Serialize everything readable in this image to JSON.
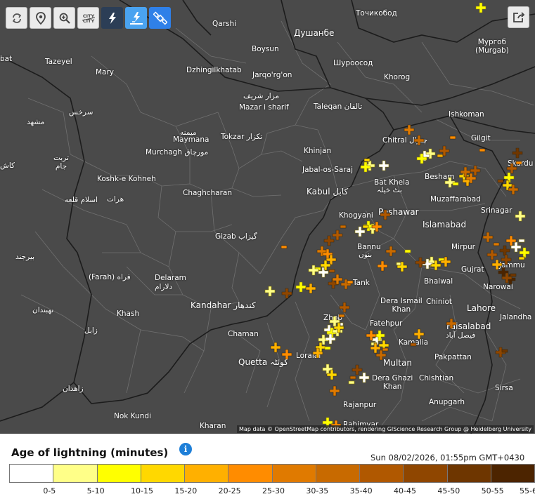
{
  "toolbar": {
    "buttons": [
      {
        "name": "refresh-icon",
        "style": "light"
      },
      {
        "name": "location-icon",
        "style": "light"
      },
      {
        "name": "zoom-icon",
        "style": "light"
      },
      {
        "name": "city-labels-icon",
        "style": "light",
        "text": "CITY"
      },
      {
        "name": "lightning-icon",
        "style": "dark"
      },
      {
        "name": "lightning-ground-icon",
        "style": "lightblue"
      },
      {
        "name": "satellite-icon",
        "style": "blue"
      }
    ],
    "share_icon": "share-icon"
  },
  "map": {
    "attribution": "Map data © OpenStreetMap contributors, rendering GIScience Research Group @ Heidelberg University",
    "colors": {
      "land": "#4a4a4a",
      "border": "#1c1c1c",
      "district": "#6a6a6a"
    },
    "labels": [
      {
        "text": "Qarshi"
      },
      {
        "text": "Душанбе"
      },
      {
        "text": "Точикобод"
      },
      {
        "text": "Boysun"
      },
      {
        "text": "Мургоб (Murgab)"
      },
      {
        "text": "bat"
      },
      {
        "text": "Tazeyel"
      },
      {
        "text": "Mary"
      },
      {
        "text": "Dzhingilkhatab"
      },
      {
        "text": "Jarqo'rg'on"
      },
      {
        "text": "Шуроосод"
      },
      {
        "text": "Khorog"
      },
      {
        "text": "مزار شریف"
      },
      {
        "text": "Mazar i sharif"
      },
      {
        "text": "Taleqan تالقان"
      },
      {
        "text": "سرخس"
      },
      {
        "text": "مشهد"
      },
      {
        "text": "Ishkoman"
      },
      {
        "text": "میمنه"
      },
      {
        "text": "Maymana"
      },
      {
        "text": "Tokzar تکزار"
      },
      {
        "text": "Gilgit"
      },
      {
        "text": "Chitral چترال"
      },
      {
        "text": "Khinjan"
      },
      {
        "text": "Murchagh مورچاق"
      },
      {
        "text": "کاش"
      },
      {
        "text": "تربت جام"
      },
      {
        "text": "Jabal-os-Saraj"
      },
      {
        "text": "Skardu"
      },
      {
        "text": "Besham"
      },
      {
        "text": "Bat Khela"
      },
      {
        "text": "بٹ خیلہ"
      },
      {
        "text": "Koshk-e Kohneh"
      },
      {
        "text": "Kabul کابل"
      },
      {
        "text": "Muzaffarabad"
      },
      {
        "text": "هرات"
      },
      {
        "text": "Chaghcharan"
      },
      {
        "text": "اسلام قلعه"
      },
      {
        "text": "Srinagar"
      },
      {
        "text": "Khogyani"
      },
      {
        "text": "Peshawar"
      },
      {
        "text": "Islamabad"
      },
      {
        "text": "Gizab گیزاب"
      },
      {
        "text": "Bannu"
      },
      {
        "text": "بنوں"
      },
      {
        "text": "Mirpur"
      },
      {
        "text": "Jammu"
      },
      {
        "text": "بیرجند"
      },
      {
        "text": "Gujrat"
      },
      {
        "text": "(Farah) فراه"
      },
      {
        "text": "Delaram"
      },
      {
        "text": "دلارام"
      },
      {
        "text": "Tank"
      },
      {
        "text": "Bhalwal"
      },
      {
        "text": "Narowal"
      },
      {
        "text": "Dera Ismail Khan"
      },
      {
        "text": "Chiniot"
      },
      {
        "text": "Lahore"
      },
      {
        "text": "نهبندان"
      },
      {
        "text": "Khash"
      },
      {
        "text": "Kandahar کندهار"
      },
      {
        "text": "Jalandha"
      },
      {
        "text": "Zhob"
      },
      {
        "text": "Fatehpur"
      },
      {
        "text": "Faisalabad"
      },
      {
        "text": "زابل"
      },
      {
        "text": "Chaman"
      },
      {
        "text": "فیصل آباد"
      },
      {
        "text": "Kamalia"
      },
      {
        "text": "Loralai"
      },
      {
        "text": "Quetta کوئٹہ"
      },
      {
        "text": "Pakpattan"
      },
      {
        "text": "Multan"
      },
      {
        "text": "Chishtian"
      },
      {
        "text": "Dera Ghazi Khan"
      },
      {
        "text": "زاهدان"
      },
      {
        "text": "Sirsa"
      },
      {
        "text": "Anupgarh"
      },
      {
        "text": "Rajanpur"
      },
      {
        "text": "Nok Kundi"
      },
      {
        "text": "Kharan"
      },
      {
        "text": "Rahimyar"
      }
    ]
  },
  "legend": {
    "title": "Age of lightning (minutes)",
    "info_icon": "info-icon",
    "timestamp": "Sun 08/02/2026, 01:55pm GMT+0430",
    "colors": [
      "#ffffff",
      "#ffff88",
      "#ffff00",
      "#ffd800",
      "#ffb000",
      "#ff8c00",
      "#e07a00",
      "#c86a00",
      "#b05800",
      "#8f4600",
      "#6e3600",
      "#4c2400"
    ],
    "ticks": [
      "0-5",
      "5-10",
      "10-15",
      "15-20",
      "20-25",
      "25-30",
      "30-35",
      "35-40",
      "40-45",
      "45-50",
      "50-55",
      "55-6"
    ]
  },
  "strikes": {
    "description_levels": "0 = 0-5 min (white) ... 11 = 55-60 min (darkest brown)",
    "points": [
      [
        526,
        236,
        1
      ],
      [
        546,
        236,
        0
      ],
      [
        520,
        238,
        2
      ],
      [
        522,
        228,
        3
      ],
      [
        612,
        219,
        1
      ],
      [
        604,
        222,
        0
      ],
      [
        600,
        226,
        2
      ],
      [
        626,
        222,
        4
      ],
      [
        582,
        185,
        6
      ],
      [
        596,
        200,
        7
      ],
      [
        632,
        215,
        8
      ],
      [
        644,
        196,
        5
      ],
      [
        660,
        251,
        3
      ],
      [
        665,
        258,
        4
      ],
      [
        640,
        260,
        1
      ],
      [
        648,
        262,
        2
      ],
      [
        670,
        254,
        6
      ],
      [
        662,
        245,
        7
      ],
      [
        676,
        243,
        8
      ],
      [
        712,
        258,
        9
      ],
      [
        724,
        253,
        2
      ],
      [
        722,
        264,
        3
      ],
      [
        730,
        270,
        7
      ],
      [
        738,
        232,
        5
      ],
      [
        728,
        240,
        8
      ],
      [
        740,
        308,
        1
      ],
      [
        718,
        357,
        10
      ],
      [
        742,
        343,
        0
      ],
      [
        734,
        352,
        0
      ],
      [
        746,
        360,
        2
      ],
      [
        727,
        343,
        5
      ],
      [
        706,
        348,
        6
      ],
      [
        694,
        338,
        7
      ],
      [
        700,
        363,
        8
      ],
      [
        720,
        370,
        9
      ],
      [
        742,
        368,
        3
      ],
      [
        707,
        377,
        4
      ],
      [
        716,
        388,
        11
      ],
      [
        726,
        398,
        11
      ],
      [
        730,
        392,
        10
      ],
      [
        721,
        396,
        9
      ],
      [
        614,
        373,
        1
      ],
      [
        608,
        376,
        0
      ],
      [
        628,
        370,
        2
      ],
      [
        634,
        373,
        4
      ],
      [
        620,
        378,
        3
      ],
      [
        598,
        374,
        9
      ],
      [
        568,
        376,
        1
      ],
      [
        572,
        380,
        3
      ],
      [
        544,
        379,
        5
      ],
      [
        556,
        358,
        7
      ],
      [
        580,
        358,
        2
      ],
      [
        530,
        326,
        1
      ],
      [
        524,
        322,
        2
      ],
      [
        512,
        330,
        0
      ],
      [
        520,
        323,
        3
      ],
      [
        536,
        323,
        5
      ],
      [
        480,
        335,
        8
      ],
      [
        468,
        343,
        9
      ],
      [
        488,
        323,
        7
      ],
      [
        458,
        358,
        6
      ],
      [
        466,
        362,
        5
      ],
      [
        471,
        370,
        4
      ],
      [
        452,
        383,
        2
      ],
      [
        446,
        385,
        1
      ],
      [
        460,
        388,
        0
      ],
      [
        463,
        378,
        3
      ],
      [
        472,
        386,
        8
      ],
      [
        474,
        404,
        9
      ],
      [
        480,
        398,
        6
      ],
      [
        492,
        405,
        7
      ],
      [
        498,
        402,
        5
      ],
      [
        428,
        409,
        2
      ],
      [
        442,
        411,
        4
      ],
      [
        384,
        415,
        1
      ],
      [
        404,
        352,
        5
      ],
      [
        408,
        418,
        9
      ],
      [
        468,
        470,
        0
      ],
      [
        476,
        458,
        1
      ],
      [
        484,
        462,
        0
      ],
      [
        472,
        474,
        2
      ],
      [
        460,
        484,
        1
      ],
      [
        456,
        495,
        3
      ],
      [
        466,
        496,
        2
      ],
      [
        452,
        503,
        4
      ],
      [
        470,
        483,
        0
      ],
      [
        480,
        472,
        1
      ],
      [
        486,
        450,
        6
      ],
      [
        490,
        438,
        8
      ],
      [
        482,
        467,
        3
      ],
      [
        536,
        484,
        0
      ],
      [
        532,
        490,
        1
      ],
      [
        540,
        478,
        2
      ],
      [
        546,
        492,
        3
      ],
      [
        534,
        496,
        4
      ],
      [
        548,
        498,
        6
      ],
      [
        542,
        506,
        7
      ],
      [
        528,
        478,
        5
      ],
      [
        508,
        527,
        9
      ],
      [
        502,
        538,
        7
      ],
      [
        476,
        557,
        6
      ],
      [
        466,
        526,
        1
      ],
      [
        472,
        534,
        3
      ],
      [
        500,
        545,
        1
      ],
      [
        518,
        538,
        0
      ],
      [
        392,
        495,
        4
      ],
      [
        408,
        505,
        5
      ],
      [
        588,
        491,
        8
      ],
      [
        596,
        476,
        4
      ],
      [
        642,
        461,
        7
      ],
      [
        712,
        502,
        9
      ],
      [
        718,
        500,
        10
      ],
      [
        466,
        602,
        2
      ],
      [
        478,
        606,
        5
      ],
      [
        684,
        11,
        2
      ],
      [
        686,
        214,
        5
      ],
      [
        736,
        218,
        10
      ],
      [
        548,
        306,
        8
      ]
    ]
  }
}
